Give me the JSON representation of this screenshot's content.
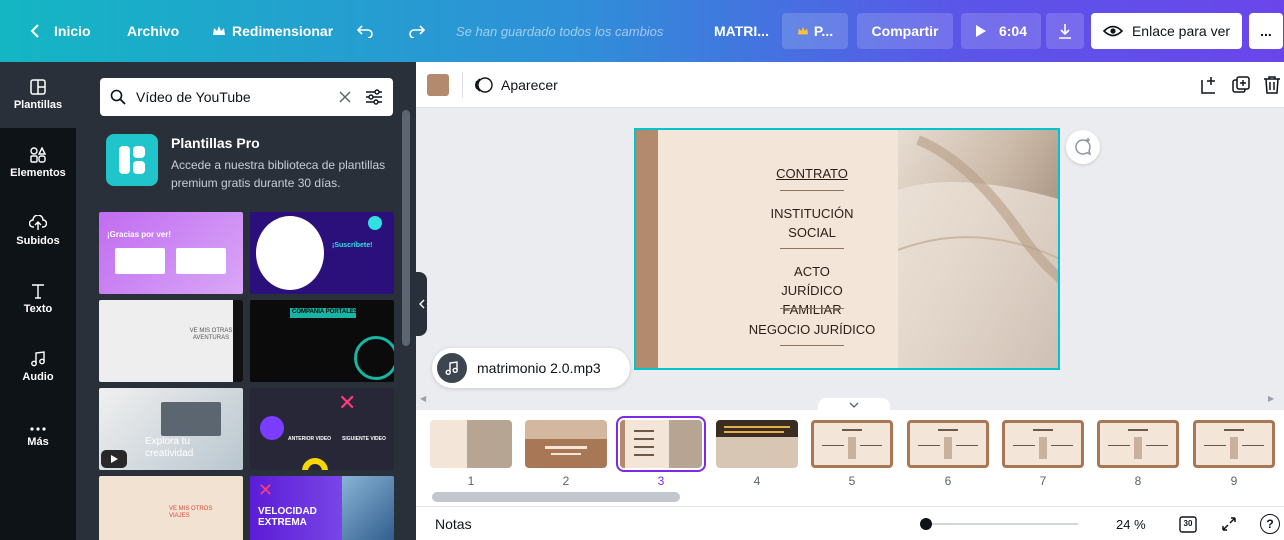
{
  "topbar": {
    "home_label": "Inicio",
    "file_label": "Archivo",
    "resize_label": "Redimensionar",
    "save_status": "Se han guardado todos los cambios",
    "doc_title": "MATRI...",
    "pro_label": "P...",
    "share_label": "Compartir",
    "present_time": "6:04",
    "view_link_label": "Enlace para ver",
    "more_label": "..."
  },
  "leftnav": {
    "items": [
      {
        "label": "Plantillas",
        "icon": "template-icon"
      },
      {
        "label": "Elementos",
        "icon": "elements-icon"
      },
      {
        "label": "Subidos",
        "icon": "upload-icon"
      },
      {
        "label": "Texto",
        "icon": "text-icon"
      },
      {
        "label": "Audio",
        "icon": "audio-icon"
      },
      {
        "label": "Más",
        "icon": "more-icon"
      }
    ]
  },
  "panel": {
    "search_value": "Vídeo de YouTube",
    "pro_title": "Plantillas Pro",
    "pro_desc": "Accede a nuestra biblioteca de plantillas premium gratis durante 30 días.",
    "thumbs": [
      {
        "text": "¡Gracias por ver!"
      },
      {
        "text": "¡Suscríbete!"
      },
      {
        "text": "VE MIS OTRAS AVENTURAS"
      },
      {
        "text": "COMPAÑÍA PORTALES"
      },
      {
        "text": "Explora tu creatividad"
      },
      {
        "text": "ANTERIOR VIDEO"
      },
      {
        "text": "SIGUIENTE VIDEO"
      },
      {
        "text": "VE MIS OTROS VIAJES"
      },
      {
        "text": "VELOCIDAD EXTREMA"
      }
    ]
  },
  "toolbar": {
    "animate_label": "Aparecer",
    "swatch_color": "#b48a6e"
  },
  "slide": {
    "items": [
      "CONTRATO",
      "INSTITUCIÓN SOCIAL",
      "ACTO JURÍDICO FAMILIAR",
      "NEGOCIO JURÍDICO"
    ]
  },
  "audio": {
    "file_name": "matrimonio 2.0.mp3"
  },
  "pages": {
    "numbers": [
      "1",
      "2",
      "3",
      "4",
      "5",
      "6",
      "7",
      "8",
      "9"
    ],
    "active": 3
  },
  "footer": {
    "notes_label": "Notas",
    "zoom_value": "24 %",
    "page_count": "30",
    "help_label": "?"
  }
}
